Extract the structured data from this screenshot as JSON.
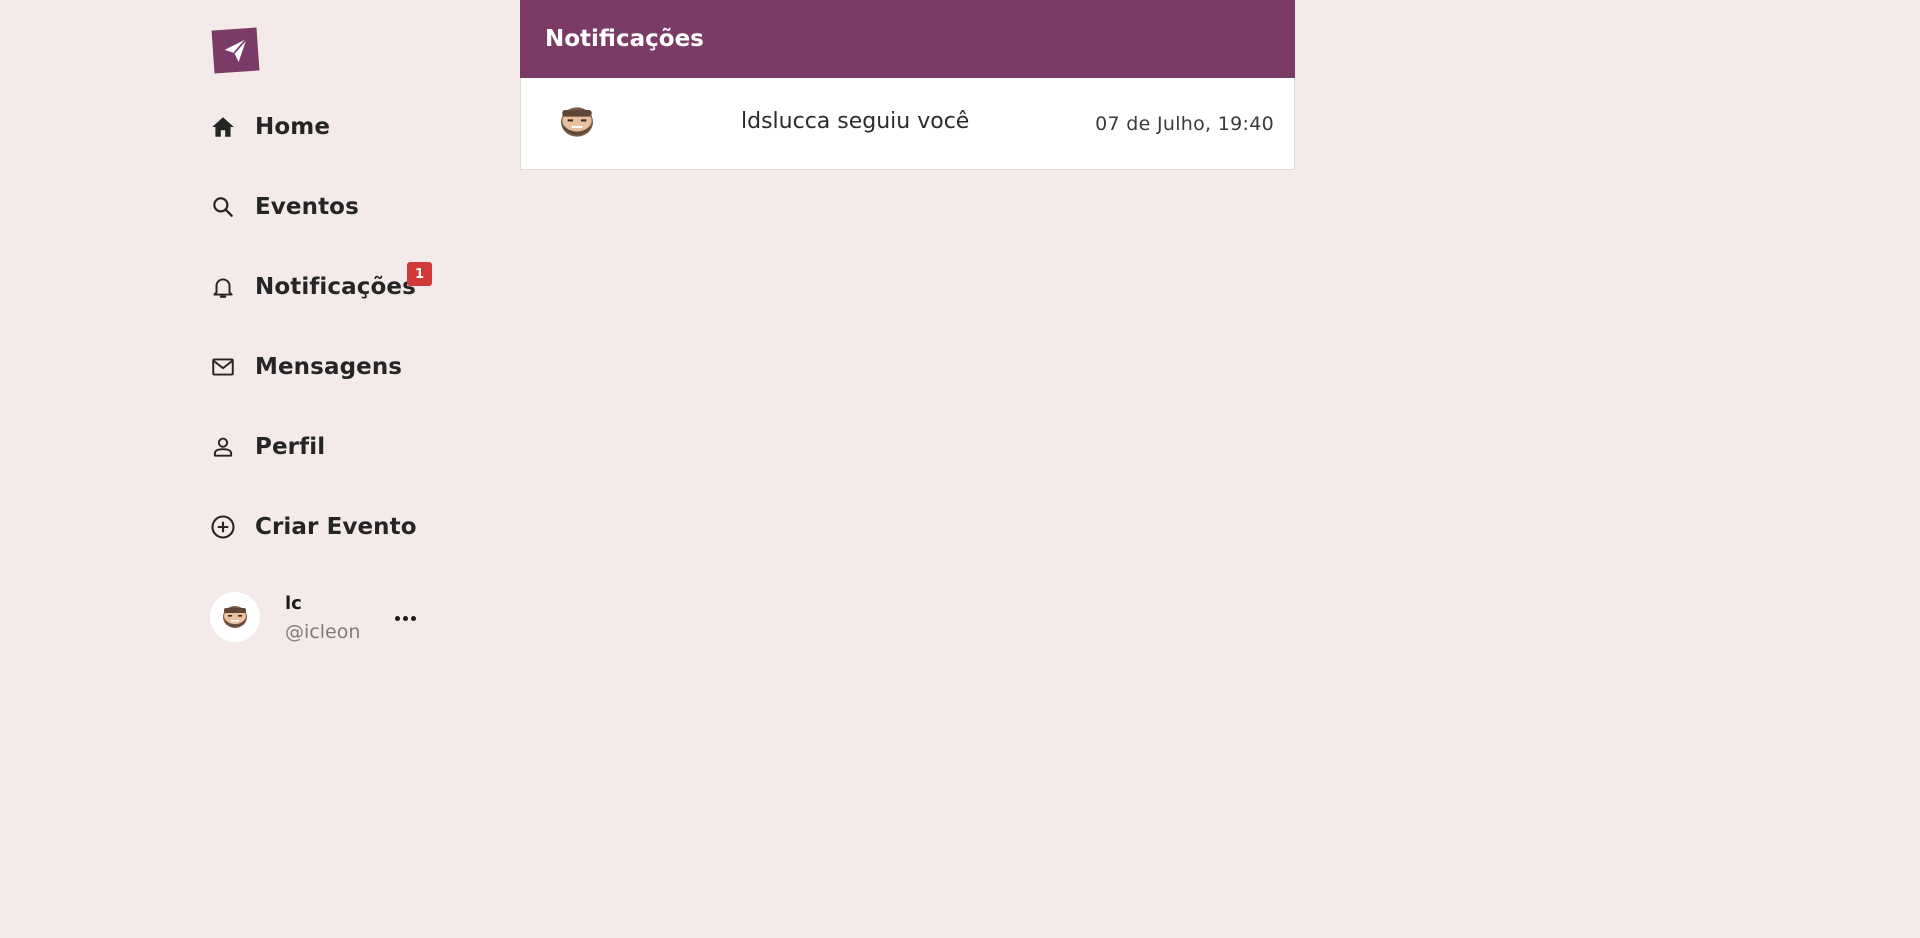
{
  "colors": {
    "brand": "#7a3c66",
    "background": "#f3eae9",
    "badge": "#d23a3a"
  },
  "logo": {
    "icon": "paper-plane-icon"
  },
  "sidebar": {
    "items": [
      {
        "label": "Home",
        "icon": "home-icon"
      },
      {
        "label": "Eventos",
        "icon": "search-icon"
      },
      {
        "label": "Notificações",
        "icon": "bell-icon",
        "badge": "1"
      },
      {
        "label": "Mensagens",
        "icon": "mail-icon"
      },
      {
        "label": "Perfil",
        "icon": "user-icon"
      },
      {
        "label": "Criar Evento",
        "icon": "plus-circle-icon"
      }
    ]
  },
  "user": {
    "name": "lc",
    "handle": "@icleon",
    "more_icon": "more-horizontal-icon"
  },
  "main": {
    "title": "Notificações",
    "notifications": [
      {
        "text": "ldslucca seguiu você",
        "time": "07 de Julho, 19:40"
      }
    ]
  }
}
